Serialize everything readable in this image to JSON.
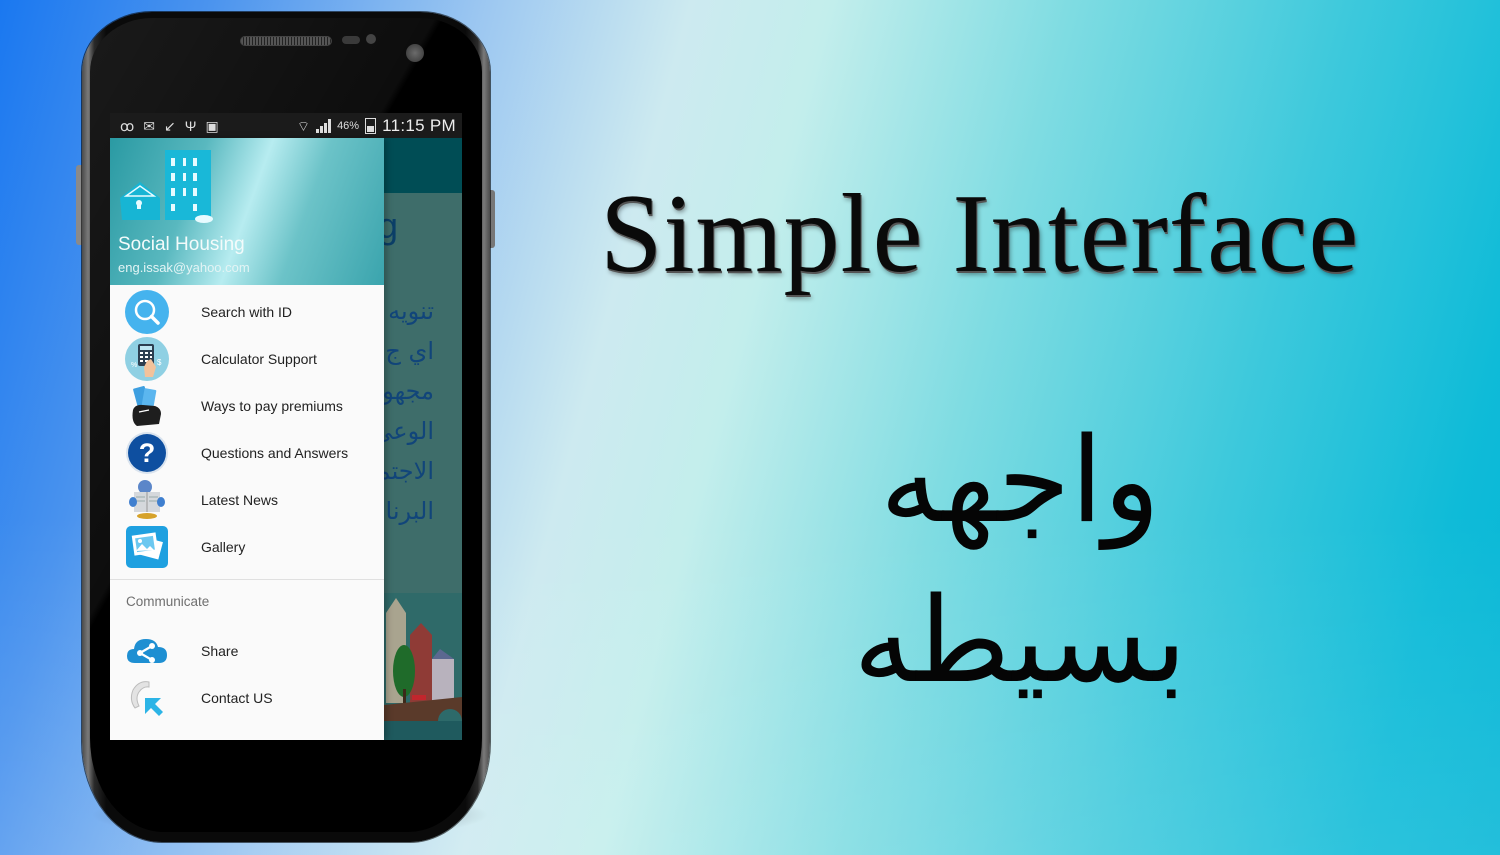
{
  "promo": {
    "headline": "Simple Interface",
    "subheadline_arabic": "واجهه بسيطه"
  },
  "status_bar": {
    "left_icons": [
      "app-notification-icon",
      "mail-icon",
      "missed-call-icon",
      "usb-icon",
      "image-icon"
    ],
    "battery_percent": "46%",
    "time": "11:15 PM"
  },
  "drawer": {
    "header": {
      "app_name": "Social Housing",
      "email": "eng.issak@yahoo.com"
    },
    "items": [
      {
        "label": "Search with ID",
        "icon": "search-icon"
      },
      {
        "label": "Calculator Support",
        "icon": "calculator-icon"
      },
      {
        "label": "Ways to pay premiums",
        "icon": "money-hand-icon"
      },
      {
        "label": "Questions and Answers",
        "icon": "question-icon"
      },
      {
        "label": "Latest News",
        "icon": "newspaper-icon"
      },
      {
        "label": "Gallery",
        "icon": "gallery-icon"
      }
    ],
    "section_title": "Communicate",
    "section_items": [
      {
        "label": "Share",
        "icon": "share-icon"
      },
      {
        "label": "Contact US",
        "icon": "contact-icon"
      }
    ]
  },
  "background_app": {
    "title_fragment": "g",
    "arabic_lines": [
      "تنويه",
      "اي ج",
      "مجهو",
      "الوعي",
      "الاجتم",
      "البرنا"
    ]
  },
  "colors": {
    "drawer_header_accent": "#2a9aa3",
    "app_toolbar": "#004d55",
    "app_background": "#3e6d6a"
  }
}
